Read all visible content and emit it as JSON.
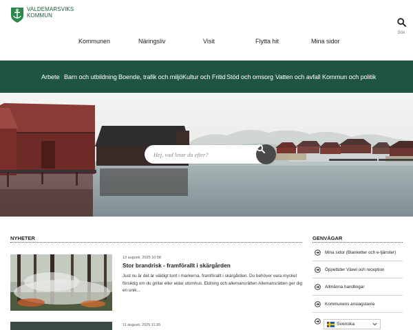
{
  "header": {
    "logo_line1": "VALDEMARSVIKS",
    "logo_line2": "KOMMUN",
    "search_label": "Sök"
  },
  "top_nav": [
    "Kommunen",
    "Näringsliv",
    "Visit",
    "Flytta hit",
    "Mina sidor"
  ],
  "main_nav": [
    "Arbete",
    "Barn och utbildning",
    "Boende, trafik och miljö",
    "Kultur och Fritid",
    "Stöd och omsorg",
    "Vatten och avfall",
    "Kommun och politik"
  ],
  "hero": {
    "search_placeholder": "Hej, vad letar du efter?"
  },
  "news": {
    "heading": "NYHETER",
    "items": [
      {
        "date": "13 augusti, 2025 10:58",
        "title": "Stor brandrisk - framförallt i skärgården",
        "text": "Just nu är det är väldigt torrt i markerna, framförallt i skärgården. Du behöver vara mycket försiktig om du grillar eller eldar utomhus. Eldning och allemansrätten Allemansrätten ger dig en unik..."
      },
      {
        "date": "11 augusti, 2025 11:35",
        "title": "",
        "text": ""
      }
    ]
  },
  "shortcuts": {
    "heading": "GENVÄGAR",
    "items": [
      "Mina sidor (Blanketter och e-tjänster)",
      "Öppettider Växel och reception",
      "Allmänna handlingar",
      "Kommunens anslagstavla",
      ""
    ]
  },
  "language": {
    "selected": "Svenska"
  },
  "colors": {
    "brand_green": "#1f5540",
    "text": "#222222"
  }
}
